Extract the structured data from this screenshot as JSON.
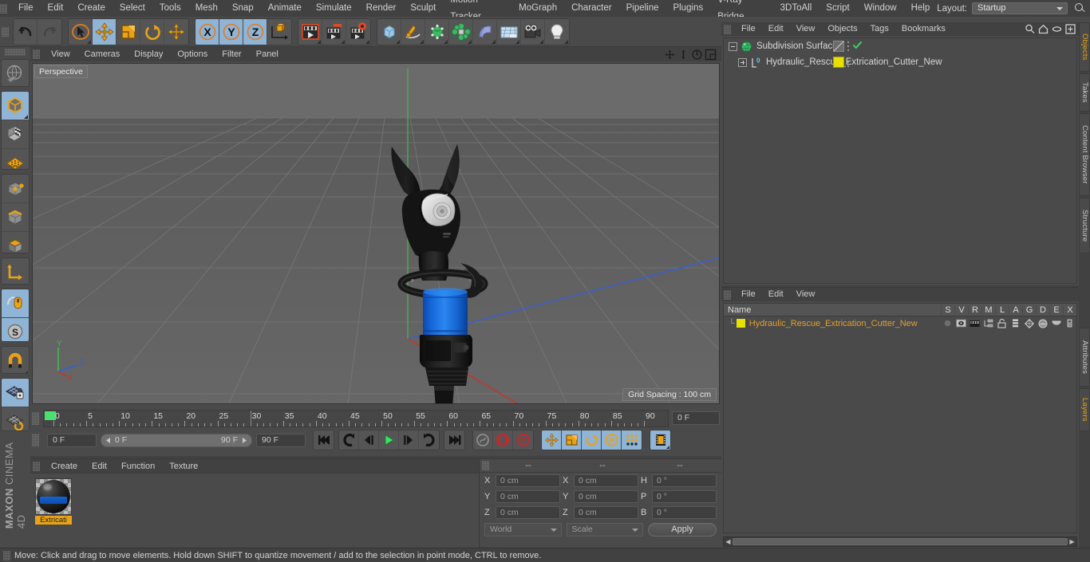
{
  "app": {
    "title": "MAXON CINEMA 4D",
    "brand_bold": "MAXON",
    "brand_light": "CINEMA 4D"
  },
  "main_menu": {
    "items": [
      "File",
      "Edit",
      "Create",
      "Select",
      "Tools",
      "Mesh",
      "Snap",
      "Animate",
      "Simulate",
      "Render",
      "Sculpt",
      "Motion Tracker",
      "MoGraph",
      "Character",
      "Pipeline",
      "Plugins",
      "V-Ray Bridge",
      "3DToAll",
      "Script",
      "Window",
      "Help"
    ],
    "layout_label": "Layout:",
    "layout_value": "Startup",
    "search_icon": "search-icon"
  },
  "toolbar": {
    "groups": [
      {
        "name": "undo-redo",
        "buttons": [
          {
            "name": "undo-button",
            "icon": "undo-arrow-icon",
            "selected": false
          },
          {
            "name": "redo-button",
            "icon": "redo-arrow-icon",
            "selected": false,
            "disabled": true
          }
        ]
      },
      {
        "name": "transform-tools",
        "buttons": [
          {
            "name": "select-tool",
            "icon": "live-selection-icon",
            "selected": false,
            "corner": true
          },
          {
            "name": "move-tool",
            "icon": "move-axis-icon",
            "selected": true
          },
          {
            "name": "scale-tool",
            "icon": "scale-box-icon",
            "selected": false
          },
          {
            "name": "rotate-tool",
            "icon": "rotate-band-icon",
            "selected": false
          },
          {
            "name": "move-alt-tool",
            "icon": "move-cross-icon",
            "selected": false
          }
        ]
      },
      {
        "name": "axis-locks",
        "buttons": [
          {
            "name": "lock-x-axis",
            "icon": "x-axis-icon",
            "selected": true
          },
          {
            "name": "lock-y-axis",
            "icon": "y-axis-icon",
            "selected": true
          },
          {
            "name": "lock-z-axis",
            "icon": "z-axis-icon",
            "selected": true
          },
          {
            "name": "world-object-coordinates",
            "icon": "world-axis-icon",
            "selected": false
          }
        ]
      },
      {
        "name": "render-tools",
        "buttons": [
          {
            "name": "render-view",
            "icon": "render-view-icon",
            "selected": false,
            "corner": true
          },
          {
            "name": "render-region",
            "icon": "render-region-icon",
            "selected": false,
            "corner": true
          },
          {
            "name": "render-settings",
            "icon": "render-settings-icon",
            "selected": false,
            "corner": true
          }
        ]
      },
      {
        "name": "create-objects",
        "buttons": [
          {
            "name": "add-primitive",
            "icon": "cube-icon",
            "selected": false,
            "corner": true
          },
          {
            "name": "add-spline",
            "icon": "pen-spline-icon",
            "selected": false,
            "corner": true
          },
          {
            "name": "add-generator",
            "icon": "green-cube-generator-icon",
            "selected": false,
            "corner": true
          },
          {
            "name": "add-deformer",
            "icon": "deformer-icon",
            "selected": false,
            "corner": true
          },
          {
            "name": "add-scene-object",
            "icon": "bend-object-icon",
            "selected": false,
            "corner": true
          },
          {
            "name": "add-environment",
            "icon": "floor-environment-icon",
            "selected": false,
            "corner": true
          },
          {
            "name": "add-camera",
            "icon": "camera-icon",
            "selected": false,
            "corner": true
          },
          {
            "name": "add-light",
            "icon": "light-bulb-icon",
            "selected": false,
            "corner": true
          }
        ]
      }
    ]
  },
  "left_tools": {
    "groups": [
      {
        "name": "viewport-mode",
        "buttons": [
          {
            "name": "make-editable",
            "icon": "make-editable-icon",
            "selected": false
          }
        ]
      },
      {
        "name": "mode-group",
        "buttons": [
          {
            "name": "model-mode",
            "icon": "model-cube-icon",
            "selected": true,
            "corner": true
          },
          {
            "name": "texture-mode",
            "icon": "texture-checker-cube-icon",
            "selected": false
          },
          {
            "name": "uv-mode",
            "icon": "uv-mesh-icon",
            "selected": false
          }
        ]
      },
      {
        "name": "component-group",
        "buttons": [
          {
            "name": "points-mode",
            "icon": "points-cube-icon",
            "selected": false
          },
          {
            "name": "edges-mode",
            "icon": "edges-cube-icon",
            "selected": false
          },
          {
            "name": "polygons-mode",
            "icon": "polygons-cube-icon",
            "selected": false
          }
        ]
      },
      {
        "name": "axis-group",
        "buttons": [
          {
            "name": "enable-axis-modification",
            "icon": "axis-corner-icon",
            "selected": false
          }
        ]
      },
      {
        "name": "viewport-solo-group",
        "buttons": [
          {
            "name": "viewport-solo-single",
            "icon": "mouse-axis-icon",
            "selected": true
          },
          {
            "name": "viewport-solo-hierarchy",
            "icon": "soft-selection-icon",
            "selected": true,
            "corner": true
          }
        ]
      },
      {
        "name": "snap-group",
        "buttons": [
          {
            "name": "enable-snapping",
            "icon": "magnet-icon",
            "selected": false,
            "corner": true
          }
        ]
      },
      {
        "name": "workplane-group",
        "buttons": [
          {
            "name": "lock-workplane",
            "icon": "workplane-lock-icon",
            "selected": true
          },
          {
            "name": "planar-workplane",
            "icon": "workplane-rotate-icon",
            "selected": false,
            "corner": true
          }
        ]
      }
    ]
  },
  "viewport": {
    "menu": [
      "View",
      "Cameras",
      "Display",
      "Options",
      "Filter",
      "Panel"
    ],
    "view_label": "Perspective",
    "grid_spacing": "Grid Spacing : 100 cm",
    "nav_icons": [
      "pan-icon",
      "dolly-icon",
      "orbit-icon",
      "maximize-viewport-icon"
    ],
    "axis_gizmo": {
      "x": "X",
      "y": "Y",
      "z": "Z"
    }
  },
  "timeline": {
    "frame_start": 0,
    "frame_end": 90,
    "tick_labels": [
      0,
      5,
      10,
      15,
      20,
      25,
      30,
      35,
      40,
      45,
      50,
      55,
      60,
      65,
      70,
      75,
      80,
      85,
      90
    ],
    "current_frame_field": "0 F",
    "current_frame_left": "0 F",
    "range_start": "0 F",
    "range_end": "90 F",
    "max_frame_field": "90 F",
    "playhead_frame": 30,
    "transport": [
      {
        "name": "go-to-start-button",
        "icon": "jump-start-icon"
      },
      {
        "name": "previous-keyframe-button",
        "icon": "prev-key-icon"
      },
      {
        "name": "step-back-button",
        "icon": "step-back-icon"
      },
      {
        "name": "play-button",
        "icon": "play-icon"
      },
      {
        "name": "step-forward-button",
        "icon": "step-forward-icon"
      },
      {
        "name": "next-keyframe-button",
        "icon": "next-key-icon"
      },
      {
        "name": "go-to-end-button",
        "icon": "jump-end-icon"
      }
    ],
    "record_group": [
      {
        "name": "record-active-objects",
        "icon": "record-key-icon"
      },
      {
        "name": "autokeying-button",
        "icon": "autokey-circle-icon"
      },
      {
        "name": "keyframe-selection-button",
        "icon": "key-question-icon"
      }
    ],
    "key_filters": [
      {
        "name": "position-key-toggle",
        "icon": "position-move-icon",
        "selected": true
      },
      {
        "name": "scale-key-toggle",
        "icon": "scale-key-icon",
        "selected": true
      },
      {
        "name": "rotation-key-toggle",
        "icon": "rotation-key-icon",
        "selected": true
      },
      {
        "name": "pla-key-toggle",
        "icon": "pla-key-icon",
        "selected": true
      },
      {
        "name": "parameter-key-toggle",
        "icon": "param-dots-icon",
        "selected": true
      }
    ],
    "filmstrip": {
      "name": "timeline-filmstrip-button",
      "icon": "filmstrip-icon",
      "selected": true
    }
  },
  "material_manager": {
    "menu": [
      "Create",
      "Edit",
      "Function",
      "Texture"
    ],
    "materials": [
      {
        "name": "Extricati",
        "preview": "dark-sphere-blue-band"
      }
    ]
  },
  "coordinates": {
    "header": [
      "--",
      "--",
      "--"
    ],
    "rows": [
      {
        "pos_label": "X",
        "pos_value": "0 cm",
        "size_label": "X",
        "size_value": "0 cm",
        "rot_label": "H",
        "rot_value": "0 °"
      },
      {
        "pos_label": "Y",
        "pos_value": "0 cm",
        "size_label": "Y",
        "size_value": "0 cm",
        "rot_label": "P",
        "rot_value": "0 °"
      },
      {
        "pos_label": "Z",
        "pos_value": "0 cm",
        "size_label": "Z",
        "size_value": "0 cm",
        "rot_label": "B",
        "rot_value": "0 °"
      }
    ],
    "space_dropdown": "World",
    "mode_dropdown": "Scale",
    "apply_button": "Apply"
  },
  "object_manager": {
    "menu": [
      "File",
      "Edit",
      "View",
      "Objects",
      "Tags",
      "Bookmarks"
    ],
    "tools": [
      "search-icon",
      "home-icon",
      "ellipse-icon",
      "add-layer-icon"
    ],
    "tree": [
      {
        "label": "Subdivision Surface",
        "icon": "subdivision-surface-icon",
        "depth": 0,
        "expander": "minus",
        "tag": "display-tag",
        "enabled_check": true
      },
      {
        "label": "Hydraulic_Rescue_Extrication_Cutter_New",
        "icon": "polygon-object-icon",
        "depth": 1,
        "expander": "plus",
        "tag": "material-tag-yellow",
        "enabled_check": false
      }
    ]
  },
  "layer_manager": {
    "menu": [
      "File",
      "Edit",
      "View"
    ],
    "columns": [
      "Name",
      "S",
      "V",
      "R",
      "M",
      "L",
      "A",
      "G",
      "D",
      "E",
      "X"
    ],
    "rows": [
      {
        "name": "Hydraulic_Rescue_Extrication_Cutter_New",
        "color": "#e8e000"
      }
    ]
  },
  "right_tabs": [
    {
      "label": "Objects",
      "active": true
    },
    {
      "label": "Takes",
      "active": false
    },
    {
      "label": "Content Browser",
      "active": false
    },
    {
      "label": "Structure",
      "active": false
    },
    {
      "label": "Attributes",
      "active": false
    },
    {
      "label": "Layers",
      "active": true
    }
  ],
  "status_bar": {
    "message": "Move: Click and drag to move elements. Hold down SHIFT to quantize movement / add to the selection in point mode, CTRL to remove."
  },
  "colors": {
    "accent_orange": "#e8a317",
    "selection_blue": "#8fb4d6",
    "panel_bg": "#4a4a4a",
    "viewport_bg": "#5e5e5e",
    "axis_x": "#c0392b",
    "axis_y": "#4caf50",
    "axis_z": "#3a5fcd",
    "model_blue": "#1565d8",
    "layer_yellow": "#e8e000"
  }
}
